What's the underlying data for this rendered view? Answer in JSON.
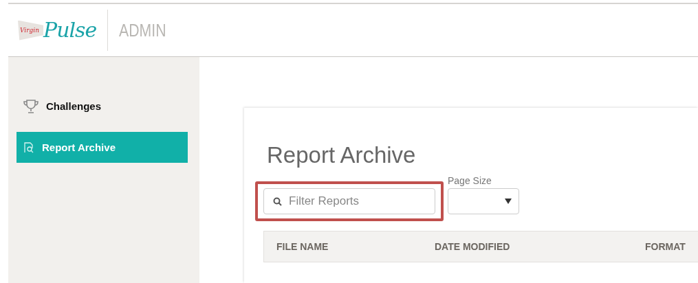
{
  "header": {
    "logo": {
      "brand": "Virgin",
      "name": "Pulse"
    },
    "section": "ADMIN"
  },
  "sidebar": {
    "items": [
      {
        "label": "Challenges",
        "kind": "trophy",
        "selected": false
      },
      {
        "label": "Report Archive",
        "kind": "report",
        "selected": true
      }
    ]
  },
  "main": {
    "title": "Report Archive",
    "filter": {
      "placeholder": "Filter Reports",
      "highlighted": true
    },
    "page_size": {
      "label": "Page Size"
    },
    "table": {
      "columns": [
        "FILE NAME",
        "DATE MODIFIED",
        "FORMAT"
      ]
    }
  }
}
